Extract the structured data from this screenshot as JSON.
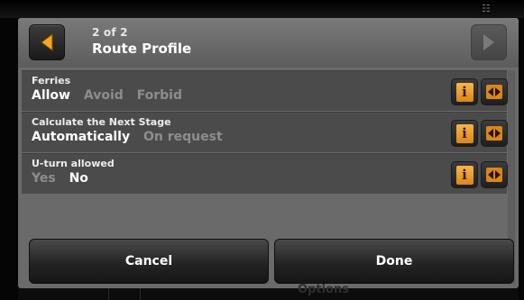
{
  "header": {
    "page_counter": "2 of 2",
    "title": "Route Profile",
    "prev_icon": "left-arrow-icon",
    "next_icon": "right-arrow-icon"
  },
  "rows": [
    {
      "title": "Ferries",
      "options": [
        {
          "label": "Allow",
          "selected": true
        },
        {
          "label": "Avoid",
          "selected": false
        },
        {
          "label": "Forbid",
          "selected": false
        }
      ]
    },
    {
      "title": "Calculate the Next Stage",
      "options": [
        {
          "label": "Automatically",
          "selected": true
        },
        {
          "label": "On request",
          "selected": false
        }
      ]
    },
    {
      "title": "U-turn allowed",
      "options": [
        {
          "label": "Yes",
          "selected": false
        },
        {
          "label": "No",
          "selected": true
        }
      ]
    }
  ],
  "row_buttons": {
    "info_glyph": "i",
    "info_icon": "info-icon",
    "toggle_icon": "toggle-arrows-icon"
  },
  "footer_buttons": {
    "cancel_label": "Cancel",
    "done_label": "Done"
  },
  "background_label": "Options",
  "colors": {
    "accent": "#f0a030",
    "arrow_orange": "#f5a623",
    "selected_text": "#ffffff",
    "unselected_text": "#8d8d8d"
  }
}
